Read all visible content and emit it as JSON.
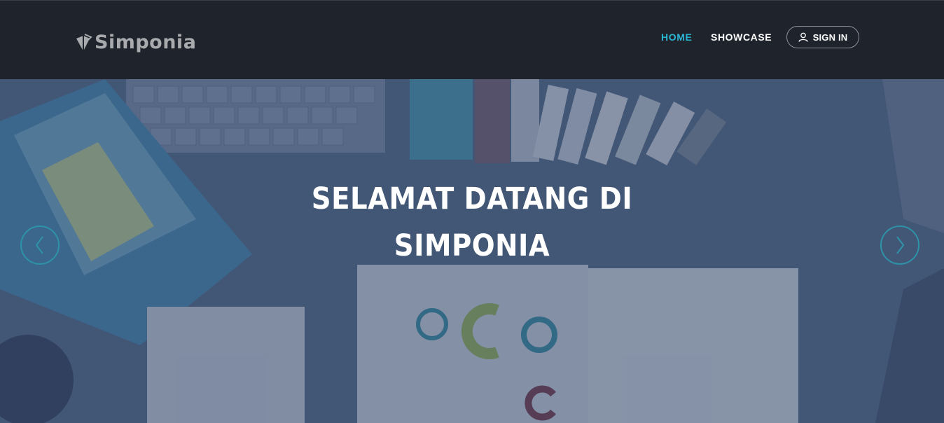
{
  "brand": {
    "name": "Simponia",
    "logo_icon": "book-logo-icon"
  },
  "nav": {
    "items": [
      {
        "label": "HOME",
        "active": true
      },
      {
        "label": "SHOWCASE",
        "active": false
      }
    ],
    "signin_label": "SIGN IN",
    "signin_icon": "user-icon"
  },
  "hero": {
    "title_line1": "SELAMAT DATANG DI",
    "title_line2": "SIMPONIA",
    "prev_icon": "chevron-left-icon",
    "next_icon": "chevron-right-icon"
  },
  "colors": {
    "navbar": "#1f232b",
    "accent": "#2bb5d4",
    "overlay": "#384a6c",
    "carousel_ring": "#2e93a8"
  }
}
